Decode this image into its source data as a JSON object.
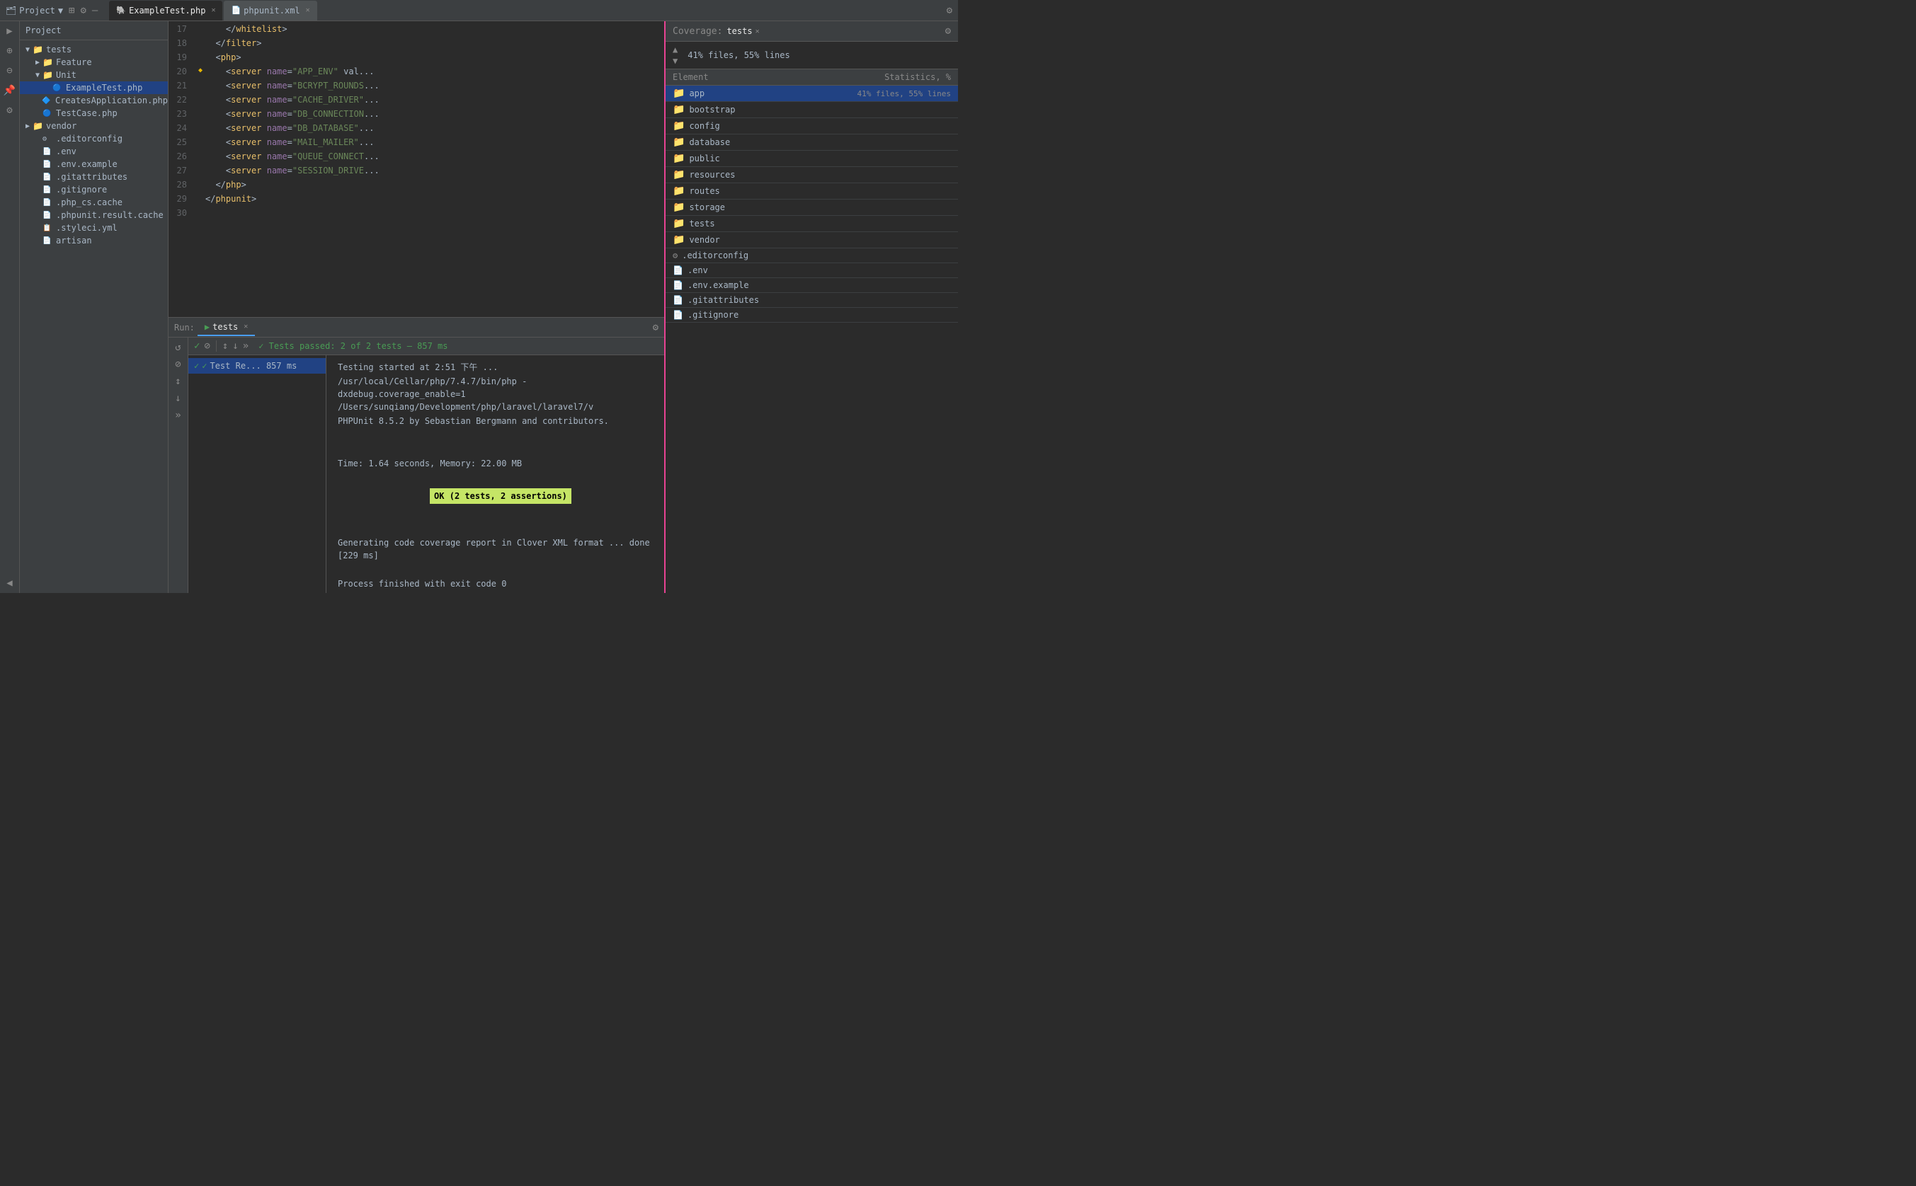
{
  "topbar": {
    "project_label": "Project",
    "tabs": [
      {
        "id": "example-test",
        "label": "ExampleTest.php",
        "icon": "php",
        "active": true
      },
      {
        "id": "phpunit-xml",
        "label": "phpunit.xml",
        "icon": "xml",
        "active": false
      }
    ]
  },
  "sidebar": {
    "header": "Project",
    "tree": [
      {
        "id": "tests",
        "label": "tests",
        "type": "folder",
        "indent": 0,
        "expanded": true,
        "arrow": "▼"
      },
      {
        "id": "feature",
        "label": "Feature",
        "type": "folder",
        "indent": 1,
        "expanded": false,
        "arrow": "▶"
      },
      {
        "id": "unit",
        "label": "Unit",
        "type": "folder",
        "indent": 1,
        "expanded": true,
        "arrow": "▼"
      },
      {
        "id": "exampletest",
        "label": "ExampleTest.php",
        "type": "php-file",
        "indent": 2,
        "arrow": ""
      },
      {
        "id": "createsapp",
        "label": "CreatesApplication.php",
        "type": "php-file",
        "indent": 1,
        "arrow": ""
      },
      {
        "id": "testcase",
        "label": "TestCase.php",
        "type": "php-file",
        "indent": 1,
        "arrow": ""
      },
      {
        "id": "vendor",
        "label": "vendor",
        "type": "folder",
        "indent": 0,
        "expanded": false,
        "arrow": "▶"
      },
      {
        "id": "editorconfig",
        "label": ".editorconfig",
        "type": "config-file",
        "indent": 0,
        "arrow": ""
      },
      {
        "id": "env",
        "label": ".env",
        "type": "text-file",
        "indent": 0,
        "arrow": ""
      },
      {
        "id": "env-example",
        "label": ".env.example",
        "type": "text-file",
        "indent": 0,
        "arrow": ""
      },
      {
        "id": "gitattributes",
        "label": ".gitattributes",
        "type": "text-file",
        "indent": 0,
        "arrow": ""
      },
      {
        "id": "gitignore",
        "label": ".gitignore",
        "type": "text-file",
        "indent": 0,
        "arrow": ""
      },
      {
        "id": "phpcs",
        "label": ".php_cs.cache",
        "type": "text-file",
        "indent": 0,
        "arrow": ""
      },
      {
        "id": "phpunit-result",
        "label": ".phpunit.result.cache",
        "type": "text-file",
        "indent": 0,
        "arrow": ""
      },
      {
        "id": "styleci",
        "label": ".styleci.yml",
        "type": "yml-file",
        "indent": 0,
        "arrow": ""
      },
      {
        "id": "artisan",
        "label": "artisan",
        "type": "text-file",
        "indent": 0,
        "arrow": ""
      }
    ]
  },
  "editor": {
    "lines": [
      {
        "num": 17,
        "gutter": "",
        "content": "    </whitelist>",
        "type": "xml"
      },
      {
        "num": 18,
        "gutter": "",
        "content": "  </filter>",
        "type": "xml"
      },
      {
        "num": 19,
        "gutter": "",
        "content": "  <php>",
        "type": "xml"
      },
      {
        "num": 20,
        "gutter": "◆",
        "content": "    <server name=\"APP_ENV\" val...",
        "type": "xml"
      },
      {
        "num": 21,
        "gutter": "",
        "content": "    <server name=\"BCRYPT_ROUNDS...",
        "type": "xml"
      },
      {
        "num": 22,
        "gutter": "",
        "content": "    <server name=\"CACHE_DRIVER\"...",
        "type": "xml"
      },
      {
        "num": 23,
        "gutter": "",
        "content": "    <server name=\"DB_CONNECTION...",
        "type": "xml"
      },
      {
        "num": 24,
        "gutter": "",
        "content": "    <server name=\"DB_DATABASE\"...",
        "type": "xml"
      },
      {
        "num": 25,
        "gutter": "",
        "content": "    <server name=\"MAIL_MAILER\"...",
        "type": "xml"
      },
      {
        "num": 26,
        "gutter": "",
        "content": "    <server name=\"QUEUE_CONNECT...",
        "type": "xml"
      },
      {
        "num": 27,
        "gutter": "",
        "content": "    <server name=\"SESSION_DRIVE...",
        "type": "xml"
      },
      {
        "num": 28,
        "gutter": "",
        "content": "  </php>",
        "type": "xml"
      },
      {
        "num": 29,
        "gutter": "",
        "content": "</phpunit>",
        "type": "xml"
      },
      {
        "num": 30,
        "gutter": "",
        "content": "",
        "type": "xml"
      }
    ]
  },
  "coverage": {
    "header_label": "Coverage:",
    "tab_label": "tests",
    "gear_icon": "⚙",
    "stats": "41% files, 55% lines",
    "up_arrow": "▲",
    "down_arrow": "▼",
    "columns": {
      "element": "Element",
      "statistics": "Statistics, %"
    },
    "rows": [
      {
        "id": "app",
        "label": "app",
        "icon": "folder-blue",
        "stats": "41% files, 55% lines",
        "selected": true
      },
      {
        "id": "bootstrap",
        "label": "bootstrap",
        "icon": "folder-blue",
        "stats": ""
      },
      {
        "id": "config",
        "label": "config",
        "icon": "folder-blue",
        "stats": ""
      },
      {
        "id": "database",
        "label": "database",
        "icon": "folder-blue",
        "stats": ""
      },
      {
        "id": "public",
        "label": "public",
        "icon": "folder-blue",
        "stats": ""
      },
      {
        "id": "resources",
        "label": "resources",
        "icon": "folder-blue",
        "stats": ""
      },
      {
        "id": "routes",
        "label": "routes",
        "icon": "folder-blue",
        "stats": ""
      },
      {
        "id": "storage",
        "label": "storage",
        "icon": "folder-blue",
        "stats": ""
      },
      {
        "id": "tests",
        "label": "tests",
        "icon": "folder-green",
        "stats": ""
      },
      {
        "id": "vendor",
        "label": "vendor",
        "icon": "folder-blue",
        "stats": ""
      },
      {
        "id": "editorconfig2",
        "label": ".editorconfig",
        "icon": "gear",
        "stats": ""
      },
      {
        "id": "env2",
        "label": ".env",
        "icon": "file",
        "stats": ""
      },
      {
        "id": "env-example2",
        "label": ".env.example",
        "icon": "file",
        "stats": ""
      },
      {
        "id": "gitattributes2",
        "label": ".gitattributes",
        "icon": "file",
        "stats": ""
      },
      {
        "id": "gitignore2",
        "label": ".gitignore",
        "icon": "file",
        "stats": ""
      }
    ]
  },
  "run": {
    "tab_label": "tests",
    "close": "✕",
    "gear": "⚙",
    "toolbar": {
      "rerun": "↺",
      "pass_icon": "✓",
      "stop": "⊘",
      "sort_asc": "↕",
      "sort_desc": "↓",
      "more": "»"
    },
    "status": "✓ Tests passed: 2 of 2 tests – 857 ms",
    "tree_items": [
      {
        "id": "test-results",
        "label": "Test Re... 857 ms",
        "status": "pass",
        "selected": true
      }
    ],
    "output_lines": [
      "Testing started at 2:51 下午 ...",
      "/usr/local/Cellar/php/7.4.7/bin/php -dxdebug.coverage_enable=1 /Users/sunqiang/Development/php/laravel/laravel7/v",
      "PHPUnit 8.5.2 by Sebastian Bergmann and contributors.",
      "",
      "",
      "Time: 1.64 seconds, Memory: 22.00 MB",
      "OK_LINE",
      "",
      "Generating code coverage report in Clover XML format ... done [229 ms]",
      "",
      "Process finished with exit code 0"
    ],
    "ok_text": "OK (2 tests, 2 assertions)"
  },
  "left_icons": [
    "▶",
    "⊕",
    "⊖",
    "📌",
    "⚙",
    "◀"
  ]
}
